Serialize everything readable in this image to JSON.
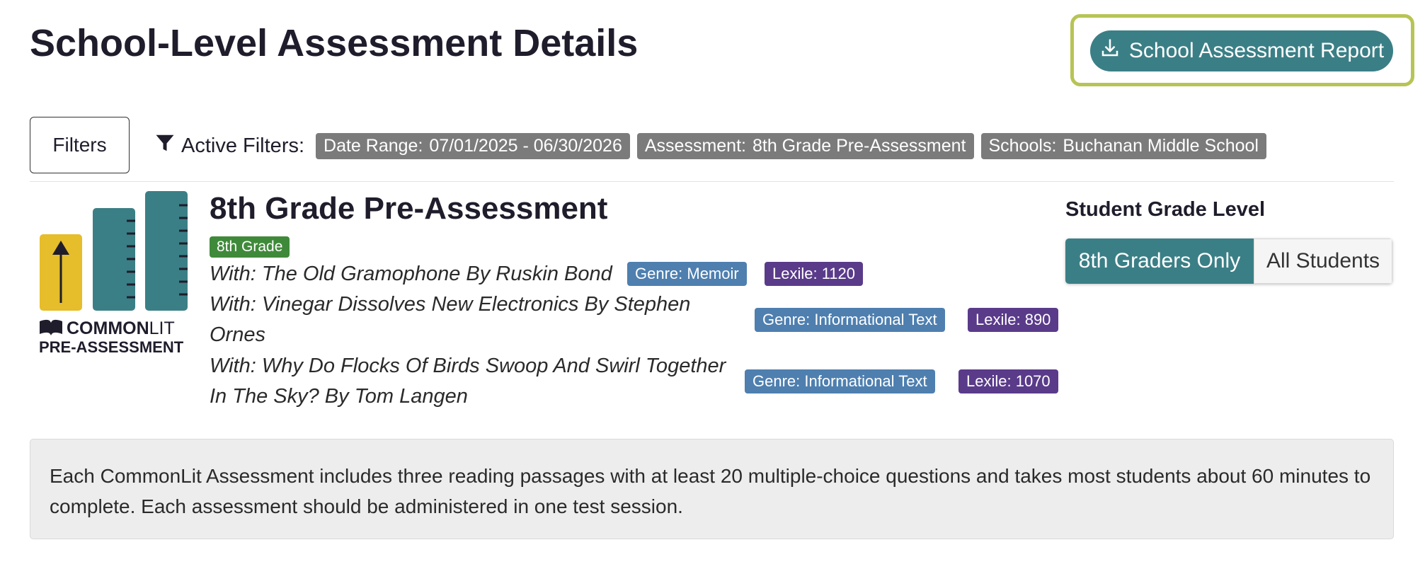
{
  "header": {
    "title": "School-Level Assessment Details",
    "report_button_label": "School Assessment Report",
    "report_outline_color": "#b7c455"
  },
  "filters": {
    "button_label": "Filters",
    "active_label": "Active Filters:",
    "chips": [
      {
        "key": "Date Range:",
        "value": "07/01/2025 - 06/30/2026"
      },
      {
        "key": "Assessment:",
        "value": "8th Grade Pre-Assessment"
      },
      {
        "key": "Schools:",
        "value": "Buchanan Middle School"
      }
    ]
  },
  "logo": {
    "brand_bold": "COMMON",
    "brand_light": "LIT",
    "subtitle": "PRE-ASSESSMENT",
    "colors": {
      "yellow": "#e6bd2a",
      "teal": "#3b7f86"
    }
  },
  "assessment": {
    "title": "8th Grade Pre-Assessment",
    "grade_badge": "8th Grade",
    "passages": [
      {
        "line1": "With: The Old Gramophone By Ruskin Bond",
        "line2": "",
        "genre": "Genre: Memoir",
        "lexile": "Lexile: 1120"
      },
      {
        "line1": "With: Vinegar Dissolves New Electronics By Stephen",
        "line2": "Ornes",
        "genre": "Genre: Informational Text",
        "lexile": "Lexile: 890"
      },
      {
        "line1": "With: Why Do Flocks Of Birds Swoop And Swirl Together",
        "line2": "In The Sky? By Tom Langen",
        "genre": "Genre: Informational Text",
        "lexile": "Lexile: 1070"
      }
    ]
  },
  "student_grade_level": {
    "title": "Student Grade Level",
    "options": [
      "8th Graders Only",
      "All Students"
    ],
    "selected": "8th Graders Only"
  },
  "info": {
    "text": "Each CommonLit Assessment includes three reading passages with at least 20 multiple-choice questions and takes most students about 60 minutes to complete. Each assessment should be administered in one test session."
  },
  "colors": {
    "accent": "#3b7f86",
    "grade_badge": "#3f8a3a",
    "genre_tag": "#4e7faf",
    "lexile_tag": "#5a3b8a",
    "filter_chip": "#7b7b7b"
  },
  "icons": {
    "report": "download-icon",
    "filter": "funnel-icon",
    "logo": "book-icon"
  }
}
